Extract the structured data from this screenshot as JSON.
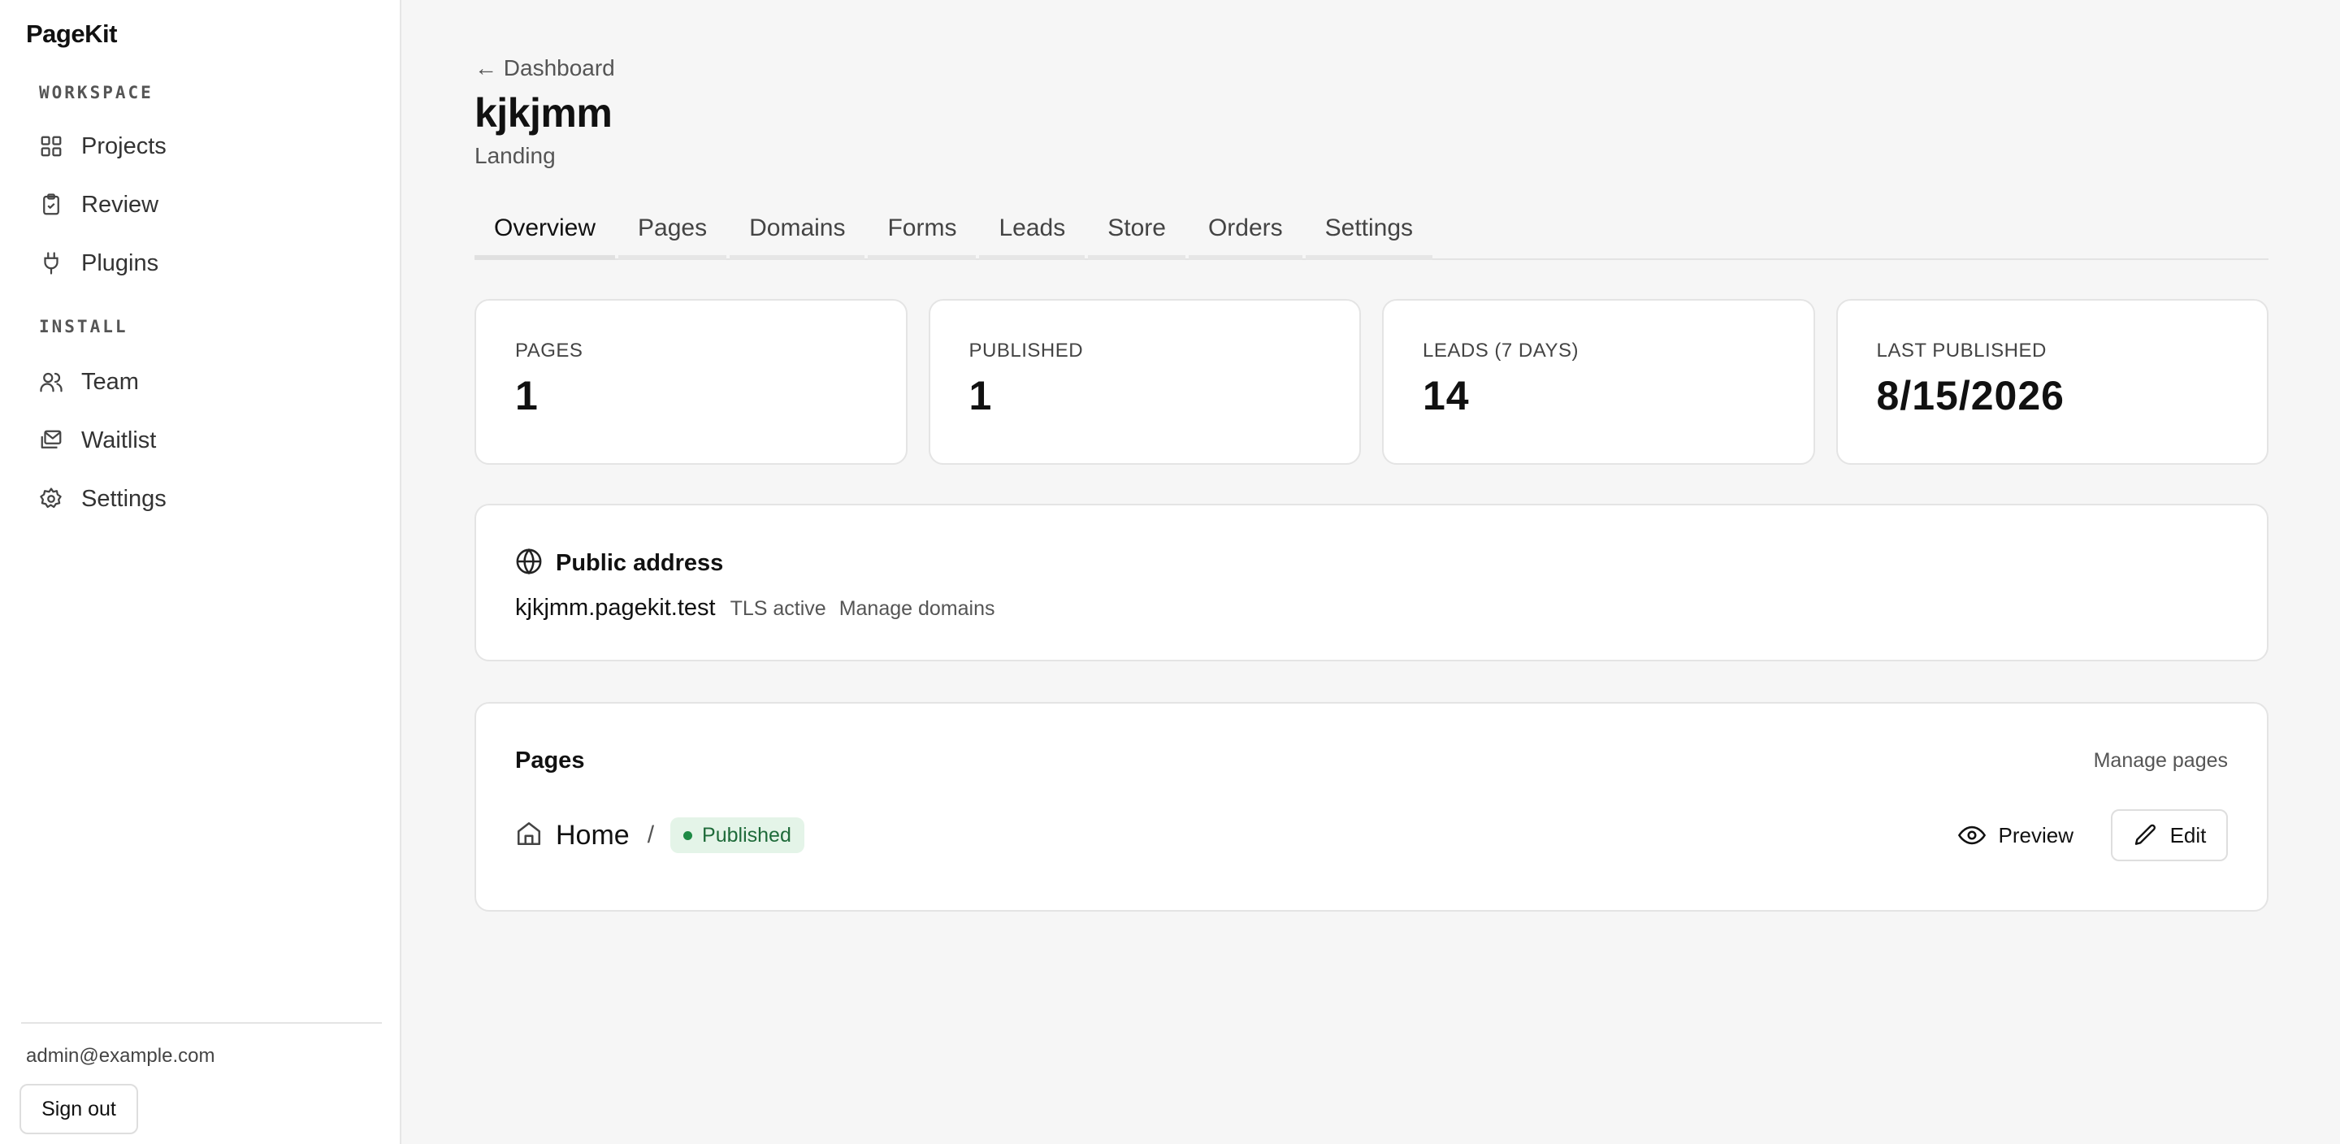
{
  "app": {
    "brand": "PageKit"
  },
  "sidebar": {
    "sections": [
      {
        "label": "WORKSPACE"
      },
      {
        "label": "INSTALL"
      }
    ],
    "items": [
      {
        "label": "Projects",
        "icon": "grid-icon"
      },
      {
        "label": "Review",
        "icon": "clipboard-check-icon"
      },
      {
        "label": "Plugins",
        "icon": "plug-icon"
      },
      {
        "label": "Team",
        "icon": "users-icon"
      },
      {
        "label": "Waitlist",
        "icon": "mail-stack-icon"
      },
      {
        "label": "Settings",
        "icon": "gear-icon"
      }
    ],
    "user_email": "admin@example.com",
    "sign_out_label": "Sign out"
  },
  "header": {
    "back_label": "← Dashboard",
    "title": "kjkjmm",
    "subtitle": "Landing"
  },
  "tabs": [
    {
      "label": "Overview",
      "active": true
    },
    {
      "label": "Pages"
    },
    {
      "label": "Domains"
    },
    {
      "label": "Forms"
    },
    {
      "label": "Leads"
    },
    {
      "label": "Store"
    },
    {
      "label": "Orders"
    },
    {
      "label": "Settings"
    }
  ],
  "stats": [
    {
      "label": "PAGES",
      "value": "1"
    },
    {
      "label": "PUBLISHED",
      "value": "1"
    },
    {
      "label": "LEADS (7 DAYS)",
      "value": "14"
    },
    {
      "label": "LAST PUBLISHED",
      "value": "8/15/2026"
    }
  ],
  "public_address": {
    "title": "Public address",
    "domain": "kjkjmm.pagekit.test",
    "tls_status": "TLS active",
    "manage_label": "Manage domains"
  },
  "pages_section": {
    "title": "Pages",
    "manage_label": "Manage pages",
    "rows": [
      {
        "name": "Home",
        "path": "/",
        "status": "Published",
        "preview_label": "Preview",
        "edit_label": "Edit"
      }
    ]
  },
  "colors": {
    "background": "#f6f6f6",
    "badge_bg": "#e4f4e8",
    "badge_text": "#1f6b3a",
    "badge_dot": "#1e8a45"
  }
}
